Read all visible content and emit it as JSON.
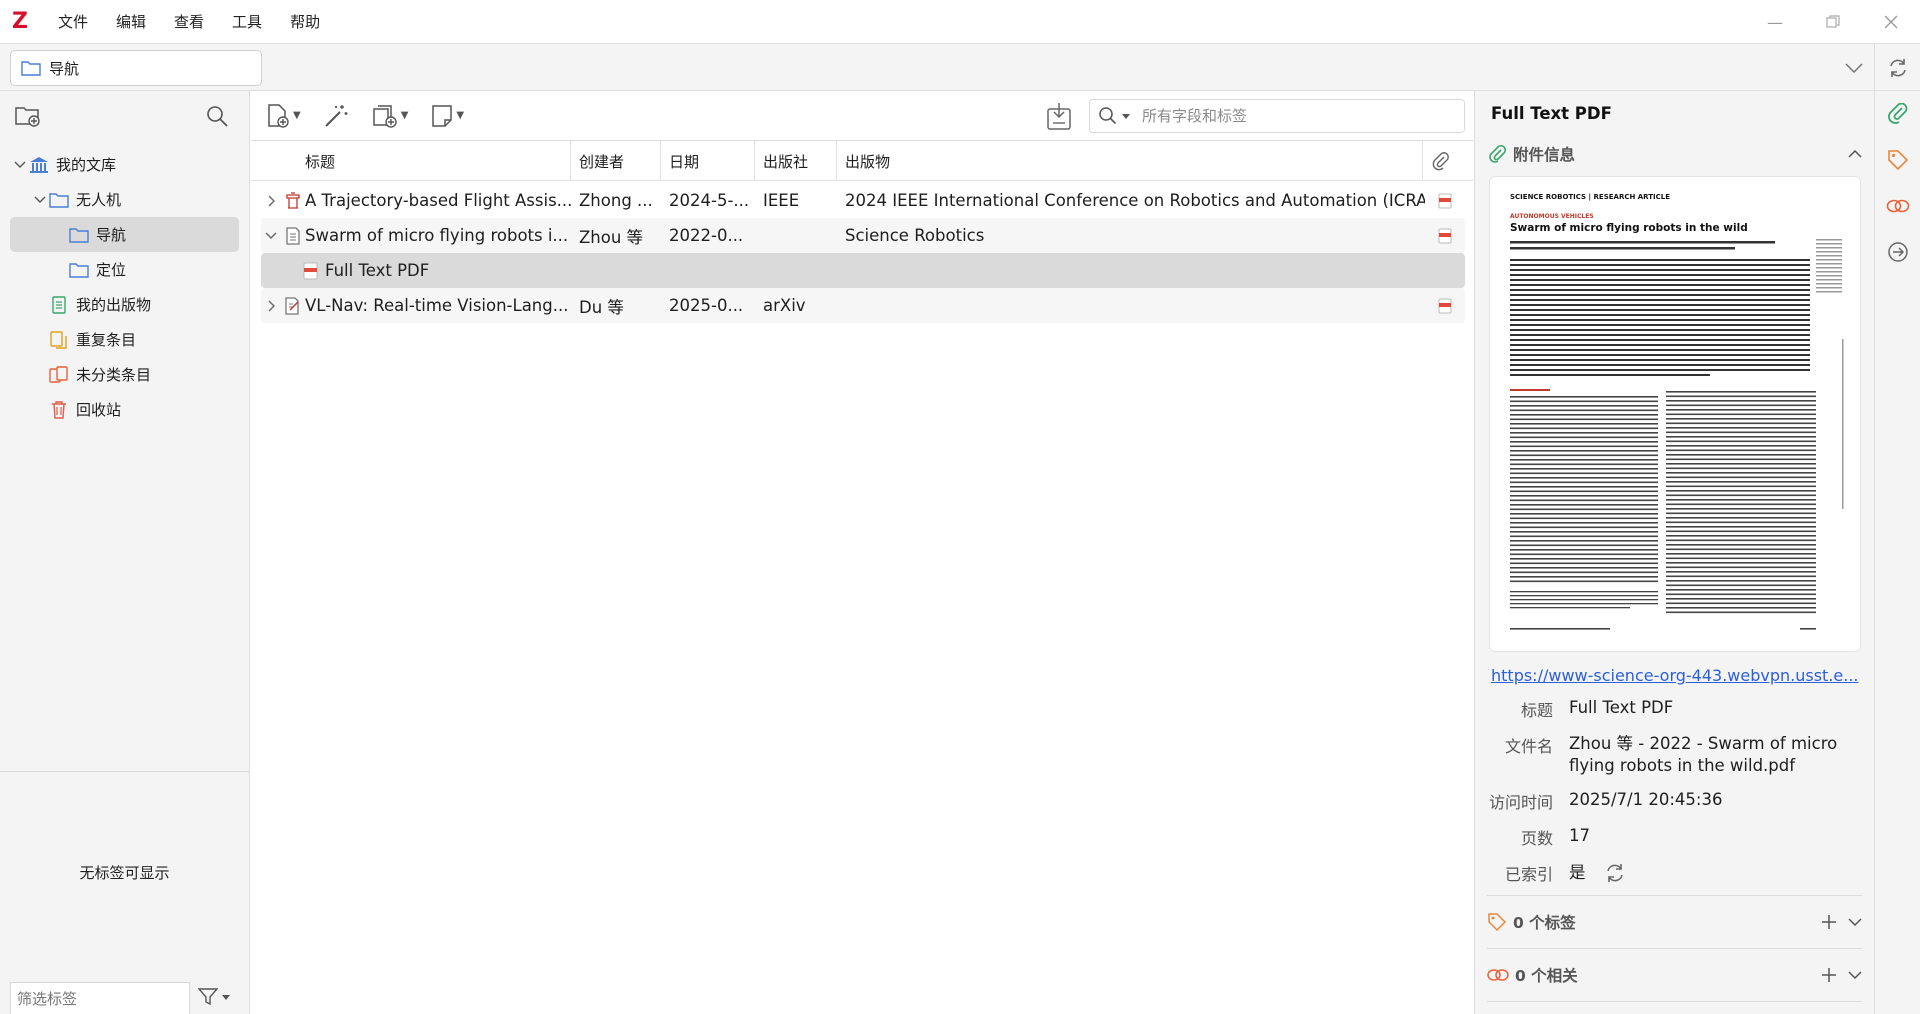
{
  "app": {
    "menu": [
      "文件",
      "编辑",
      "查看",
      "工具",
      "帮助"
    ]
  },
  "location_tab": {
    "label": "导航"
  },
  "left_pane": {
    "tree": [
      {
        "label": "我的文库",
        "level": 0,
        "twisty": "open",
        "icon": "library-icon"
      },
      {
        "label": "无人机",
        "level": 1,
        "twisty": "open",
        "icon": "folder-icon"
      },
      {
        "label": "导航",
        "level": 2,
        "twisty": "",
        "icon": "folder-icon",
        "selected": true
      },
      {
        "label": "定位",
        "level": 2,
        "twisty": "",
        "icon": "folder-icon"
      },
      {
        "label": "我的出版物",
        "level": 1,
        "twisty": "",
        "icon": "publications-icon"
      },
      {
        "label": "重复条目",
        "level": 1,
        "twisty": "",
        "icon": "duplicates-icon"
      },
      {
        "label": "未分类条目",
        "level": 1,
        "twisty": "",
        "icon": "unfiled-icon"
      },
      {
        "label": "回收站",
        "level": 1,
        "twisty": "",
        "icon": "trash-icon"
      }
    ],
    "no_tags": "无标签可显示",
    "tag_filter_placeholder": "筛选标签"
  },
  "center": {
    "search_placeholder": "所有字段和标签",
    "columns": [
      "标题",
      "创建者",
      "日期",
      "出版社",
      "出版物"
    ],
    "rows": [
      {
        "twisty": "›",
        "icon": "conference-paper-icon",
        "title": "A Trajectory-based Flight Assis...",
        "creator": "Zhong ...",
        "date": "2024-5-...",
        "publisher": "IEEE",
        "publication": "2024 IEEE International Conference on Robotics and Automation (ICRA)",
        "has_pdf": true
      },
      {
        "twisty": "⌄",
        "icon": "journal-article-icon",
        "title": "Swarm of micro flying robots i...",
        "creator": "Zhou 等",
        "date": "2022-0...",
        "publisher": "",
        "publication": "Science Robotics",
        "has_pdf": true
      },
      {
        "twisty": "",
        "icon": "pdf-icon",
        "title": "Full Text PDF",
        "creator": "",
        "date": "",
        "publisher": "",
        "publication": "",
        "has_pdf": false,
        "child": true,
        "selected": true
      },
      {
        "twisty": "›",
        "icon": "preprint-icon",
        "title": "VL-Nav: Real-time Vision-Lang...",
        "creator": "Du 等",
        "date": "2025-0...",
        "publisher": "arXiv",
        "publication": "",
        "has_pdf": true
      }
    ]
  },
  "right_pane": {
    "title": "Full Text PDF",
    "attachment_section": "附件信息",
    "preview": {
      "journal": "SCIENCE ROBOTICS | RESEARCH ARTICLE",
      "kicker": "AUTONOMOUS VEHICLES",
      "article_title": "Swarm of micro flying robots in the wild"
    },
    "url": "https://www-science-org-443.webvpn.usst.e...",
    "meta": [
      {
        "key": "标题",
        "value": "Full Text PDF"
      },
      {
        "key": "文件名",
        "value": "Zhou 等 - 2022 - Swarm of micro flying robots in the wild.pdf"
      },
      {
        "key": "访问时间",
        "value": "2025/7/1 20:45:36"
      },
      {
        "key": "页数",
        "value": "17"
      },
      {
        "key": "已索引",
        "value": "是"
      }
    ],
    "tags_section": "0 个标签",
    "related_section": "0 个相关"
  },
  "colors": {
    "accent": "#d6102c",
    "folder": "#4a7fd6",
    "link": "#2b5fd9",
    "selection": "#dadada",
    "tag": "#e8873a",
    "attachment": "#3aa76d"
  }
}
